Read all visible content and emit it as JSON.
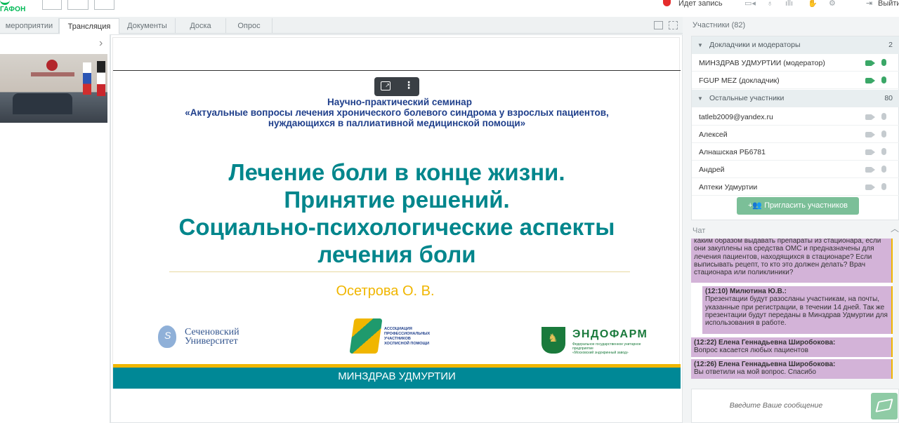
{
  "topbar": {
    "logo_text": "ГАФОН",
    "recording_text": "Идет запись",
    "exit_label": "Выйти",
    "icons": [
      "camera-icon",
      "microphone-icon",
      "signal-bars-icon",
      "raise-hand-icon",
      "settings-icon"
    ]
  },
  "tabs": [
    {
      "label": "мероприятии"
    },
    {
      "label": "Трансляция",
      "active": true
    },
    {
      "label": "Документы"
    },
    {
      "label": "Доска"
    },
    {
      "label": "Опрос"
    }
  ],
  "slide": {
    "seminar_line1": "Научно-практический  семинар",
    "seminar_line2": "«Актуальные  вопросы лечения хронического болевого синдрома у взрослых пациентов,",
    "seminar_line3": "нуждающихся  в паллиативной медицинской помощи»",
    "title_line1": "Лечение боли в конце жизни.",
    "title_line2": "Принятие решений.",
    "title_line3": "Социально-психологические аспекты",
    "title_line4": "лечения боли",
    "author": "Осетрова О. В.",
    "logo1_line1": "Сеченовский",
    "logo1_line2": "Университет",
    "logo1_mark": "S",
    "logo2_line1": "АССОЦИАЦИЯ",
    "logo2_line2": "ПРОФЕССИОНАЛЬНЫХ",
    "logo2_line3": "УЧАСТНИКОВ",
    "logo2_line4": "ХОСПИСНОЙ ПОМОЩИ",
    "logo3_name": "ЭНДОФАРМ",
    "logo3_sub1": "Федеральное государственное унитарное предприятие",
    "logo3_sub2": "«Московский эндокринный завод»",
    "logo3_mark": "♞",
    "band_text": "МИНЗДРАВ УДМУРТИИ"
  },
  "participants": {
    "header": "Участники (82)",
    "groups": [
      {
        "title": "Докладчики и модераторы",
        "count": "2",
        "people": [
          {
            "name": "МИНЗДРАВ УДМУРТИИ (модератор)",
            "cam_on": true,
            "mic_on": true
          },
          {
            "name": "FGUP MEZ (докладчик)",
            "cam_on": true,
            "mic_on": true
          }
        ]
      },
      {
        "title": "Остальные участники",
        "count": "80",
        "people": [
          {
            "name": "tatleb2009@yandex.ru",
            "cam_on": false,
            "mic_on": false
          },
          {
            "name": "Алексей",
            "cam_on": false,
            "mic_on": false
          },
          {
            "name": "Алнашская РБ6781",
            "cam_on": false,
            "mic_on": false
          },
          {
            "name": "Андрей",
            "cam_on": false,
            "mic_on": false
          },
          {
            "name": "Аптеки Удмуртии",
            "cam_on": false,
            "mic_on": false
          }
        ]
      }
    ],
    "invite_label": "Пригласить участников",
    "invite_icon": "+👥"
  },
  "chat": {
    "header": "Чат",
    "messages": [
      {
        "author": "",
        "text": "каким образом выдавать препараты из стационара, если они закуплены на средства ОМС и предназначены для лечения пациентов, находящихся в стационаре? Если выписывать рецепт, то кто это должен делать? Врач стационара или поликлиники?"
      },
      {
        "author": "(12:10) Милютина Ю.В.:",
        "text": "Презентации будут разосланы участникам, на почты, указанные при регистрации, в течении 14 дней. Так же презентации будут переданы в Минздрав Удмуртии для использования в работе."
      },
      {
        "author": "(12:22) Елена Геннадьевна Широбокова:",
        "text": "Вопрос касается любых пациентов"
      },
      {
        "author": "(12:26) Елена Геннадьевна Широбокова:",
        "text": "Вы ответили на мой вопрос. Спасибо"
      }
    ],
    "input_placeholder": "Введите Ваше сообщение"
  },
  "colors": {
    "accent_green": "#00b956",
    "slide_teal": "#00868c",
    "slide_blue": "#1f3f8b",
    "slide_yellow": "#f0b600",
    "chat_bubble": "#d3b3d8",
    "record_red": "#e52b2b"
  }
}
